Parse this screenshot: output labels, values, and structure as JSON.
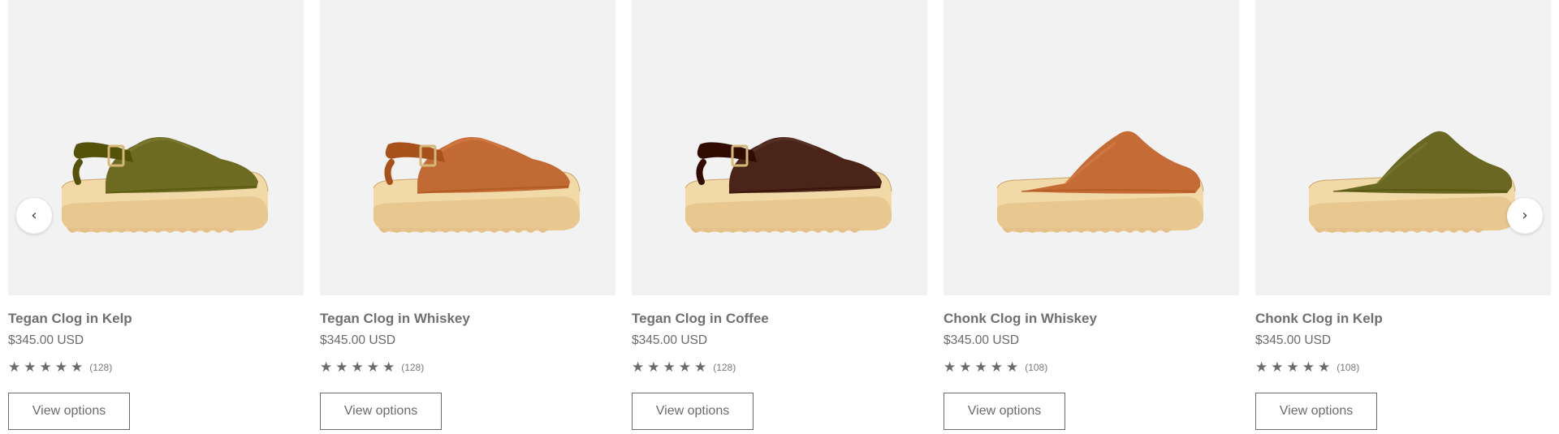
{
  "carousel": {
    "prev_icon": "chevron-left-icon",
    "next_icon": "chevron-right-icon",
    "products": [
      {
        "title": "Tegan Clog in Kelp",
        "price": "$345.00 USD",
        "stars": "★★★★★",
        "rating_count": "(128)",
        "button_label": "View options",
        "style": "tegan",
        "upper_color": "#6d6a22"
      },
      {
        "title": "Tegan Clog in Whiskey",
        "price": "$345.00 USD",
        "stars": "★★★★★",
        "rating_count": "(128)",
        "button_label": "View options",
        "style": "tegan",
        "upper_color": "#c26a33"
      },
      {
        "title": "Tegan Clog in Coffee",
        "price": "$345.00 USD",
        "stars": "★★★★★",
        "rating_count": "(128)",
        "button_label": "View options",
        "style": "tegan",
        "upper_color": "#4a2418"
      },
      {
        "title": "Chonk Clog in Whiskey",
        "price": "$345.00 USD",
        "stars": "★★★★★",
        "rating_count": "(108)",
        "button_label": "View options",
        "style": "chonk",
        "upper_color": "#c56b35"
      },
      {
        "title": "Chonk Clog in Kelp",
        "price": "$345.00 USD",
        "stars": "★★★★★",
        "rating_count": "(108)",
        "button_label": "View options",
        "style": "chonk",
        "upper_color": "#6a6722"
      }
    ]
  }
}
